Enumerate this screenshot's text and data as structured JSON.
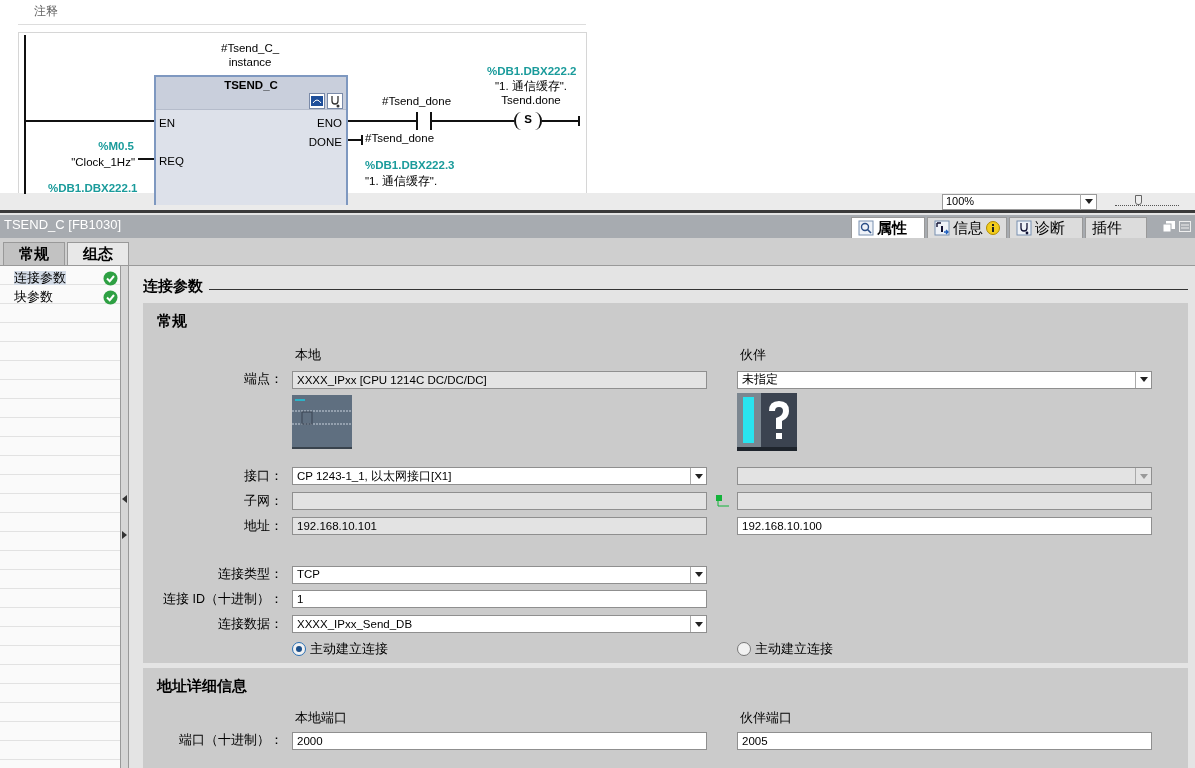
{
  "editor": {
    "comment_label": "注释",
    "network": {
      "instance": "#Tsend_C_\ninstance",
      "block": {
        "name": "TSEND_C",
        "inputs": [
          {
            "pin": "EN"
          },
          {
            "pin": "REQ",
            "address": "%M0.5",
            "symbol": "\"Clock_1Hz\""
          }
        ],
        "outputs": [
          {
            "pin": "ENO"
          },
          {
            "pin": "DONE",
            "operand": "#Tsend_done",
            "address": "%DB1.DBX222.3",
            "symbol": "\"1. 通信缓存\"."
          }
        ],
        "next_address": "%DB1.DBX222.1"
      },
      "contact": {
        "operand": "#Tsend_done"
      },
      "coil": {
        "label": "S",
        "address": "%DB1.DBX222.2",
        "symbol": "\"1. 通信缓存\".\nTsend.done"
      }
    }
  },
  "zoom": {
    "value": "100%",
    "level": 0.35
  },
  "inspector": {
    "title": "TSEND_C [FB1030]",
    "tabs": [
      {
        "label": "属性",
        "selected": true
      },
      {
        "label": "信息",
        "selected": false,
        "badge": true
      },
      {
        "label": "诊断",
        "selected": false
      },
      {
        "label": "插件",
        "selected": false
      }
    ],
    "subtabs": [
      {
        "label": "常规",
        "selected": false
      },
      {
        "label": "组态",
        "selected": true
      }
    ],
    "nav": [
      {
        "label": "连接参数",
        "selected": true,
        "valid": true
      },
      {
        "label": "块参数",
        "selected": false,
        "valid": true
      }
    ],
    "heading": "连接参数",
    "sections": [
      {
        "title": "常规",
        "local_header": "本地",
        "partner_header": "伙伴",
        "rows": [
          {
            "kind": "field",
            "label": "端点：",
            "local": {
              "kind": "text",
              "value": "XXXX_IPxx [CPU 1214C DC/DC/DC]",
              "disabled": true
            },
            "partner": {
              "kind": "dropdown",
              "value": "未指定",
              "disabled": false
            }
          },
          {
            "kind": "images"
          },
          {
            "kind": "field",
            "label": "接口：",
            "local": {
              "kind": "dropdown",
              "value": "CP 1243-1_1, 以太网接口[X1]",
              "disabled": false
            },
            "partner": {
              "kind": "dropdown",
              "disabled": true
            }
          },
          {
            "kind": "field",
            "label": "子网：",
            "local": {
              "kind": "text",
              "disabled": true
            },
            "link": true,
            "partner": {
              "kind": "text",
              "disabled": true
            }
          },
          {
            "kind": "field",
            "label": "地址：",
            "local": {
              "kind": "text",
              "value": "192.168.10.101",
              "disabled": true
            },
            "partner": {
              "kind": "text",
              "value": "192.168.10.100",
              "disabled": false
            }
          },
          {
            "kind": "spacer"
          },
          {
            "kind": "field",
            "label": "连接类型：",
            "local": {
              "kind": "dropdown",
              "value": "TCP",
              "disabled": false
            }
          },
          {
            "kind": "field",
            "label": "连接 ID（十进制）：",
            "local": {
              "kind": "text",
              "value": "1",
              "disabled": false
            }
          },
          {
            "kind": "field",
            "label": "连接数据：",
            "local": {
              "kind": "dropdown",
              "value": "XXXX_IPxx_Send_DB",
              "disabled": false
            }
          },
          {
            "kind": "radio",
            "local": {
              "label": "主动建立连接",
              "selected": true
            },
            "partner": {
              "label": "主动建立连接",
              "selected": false
            }
          }
        ]
      },
      {
        "title": "地址详细信息",
        "local_header": "本地端口",
        "partner_header": "伙伴端口",
        "rows": [
          {
            "kind": "field",
            "label": "端口（十进制）：",
            "local": {
              "kind": "text",
              "value": "2000",
              "disabled": false
            },
            "partner": {
              "kind": "text",
              "value": "2005",
              "disabled": false
            }
          }
        ]
      }
    ]
  }
}
